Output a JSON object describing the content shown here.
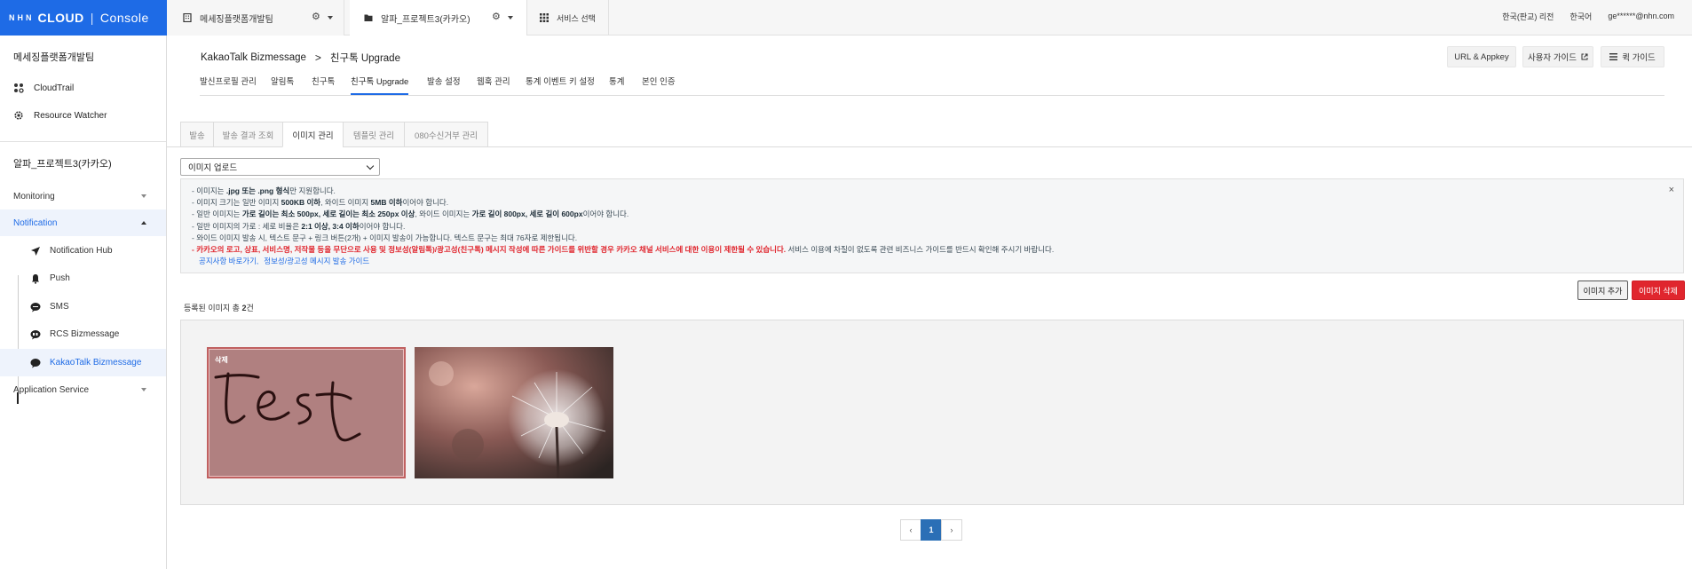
{
  "topbar": {
    "logo_brand": "NHN",
    "logo_cloud": "CLOUD",
    "logo_sep": "|",
    "logo_console": "Console",
    "org_name": "메세징플랫폼개발팀",
    "project_name": "알파_프로젝트3(카카오)",
    "service_select": "서비스 선택",
    "region": "한국(판교) 리전",
    "language": "한국어",
    "user": "ge******@nhn.com"
  },
  "sidebar": {
    "org_title": "메세징플랫폼개발팀",
    "org_links": [
      {
        "label": "CloudTrail",
        "icon": "cloudtrail-icon"
      },
      {
        "label": "Resource Watcher",
        "icon": "gear-icon"
      }
    ],
    "project_title": "알파_프로젝트3(카카오)",
    "categories": {
      "monitoring": "Monitoring",
      "notification": "Notification",
      "application_service": "Application Service"
    },
    "notification_items": [
      {
        "label": "Notification Hub",
        "icon": "paper-plane-icon"
      },
      {
        "label": "Push",
        "icon": "bell-icon"
      },
      {
        "label": "SMS",
        "icon": "sms-icon"
      },
      {
        "label": "RCS Bizmessage",
        "icon": "rcs-icon"
      },
      {
        "label": "KakaoTalk Bizmessage",
        "icon": "chat-bubble-icon"
      }
    ]
  },
  "header": {
    "breadcrumb_root": "KakaoTalk Bizmessage",
    "breadcrumb_arrow": ">",
    "breadcrumb_current": "친구톡 Upgrade",
    "buttons": {
      "appkey": "URL & Appkey",
      "user_guide": "사용자 가이드",
      "quick_guide": "퀵 가이드"
    },
    "tabs": [
      "발신프로필 관리",
      "알림톡",
      "친구톡",
      "친구톡 Upgrade",
      "발송 설정",
      "웹훅 관리",
      "통계 이벤트 키 설정",
      "통계",
      "본인 인증"
    ],
    "active_tab": "친구톡 Upgrade"
  },
  "sub_tabs": [
    "발송",
    "발송 결과 조회",
    "이미지 관리",
    "템플릿 관리",
    "080수신거부 관리"
  ],
  "active_sub_tab": "이미지 관리",
  "upload_select": {
    "value": "이미지 업로드"
  },
  "notice": {
    "l1_a": "- 이미지는 ",
    "l1_b": ".jpg 또는 .png 형식",
    "l1_c": "만 지원합니다.",
    "l2_a": "- 이미지 크기는 일반 이미지 ",
    "l2_b": "500KB 이하",
    "l2_c": ", 와이드 이미지 ",
    "l2_d": "5MB 이하",
    "l2_e": "이어야 합니다.",
    "l3_a": "- 일반 이미지는 ",
    "l3_b": "가로 길이는 최소 500px, 세로 길이는 최소 250px 이상",
    "l3_c": ", 와이드 이미지는 ",
    "l3_d": "가로 길이 800px, 세로 길이 600px",
    "l3_e": "이어야 합니다.",
    "l4_a": "- 일반 이미지의 가로 : 세로 비율은 ",
    "l4_b": "2:1 이상, 3:4 이하",
    "l4_c": "이어야 합니다.",
    "l5": "- 와이드 이미지 발송 시, 텍스트 문구 + 링크 버튼(2개) + 이미지 발송이 가능합니다. 텍스트 문구는 최대 76자로 제한됩니다.",
    "l6_a": "- 카카오의 로고, 상표, 서비스명, 저작물 등을 무단으로 사용 및 정보성(알림톡)/광고성(친구톡) 메시지 작성에 따른 가이드를 위반할 경우 카카오 채널 서비스에 대한 이용이 제한될 수 있습니다.",
    "l6_b": " 서비스 이용에 차질이 없도록 관련 비즈니스 가이드를 반드시 확인해 주시기 바랍니다.",
    "link1": "공지사항 바로가기,",
    "link2": "정보성/광고성 메시지 발송 가이드",
    "close": "×"
  },
  "actions": {
    "add": "이미지 추가",
    "delete": "이미지 삭제"
  },
  "count": {
    "prefix": "등록된 이미지 총 ",
    "num": "2",
    "suffix": "건"
  },
  "images": [
    {
      "label": "삭제",
      "selected": true,
      "content": "test"
    },
    {
      "label": "",
      "selected": false,
      "content": "dandelion"
    }
  ],
  "pagination": {
    "prev": "‹",
    "current": "1",
    "next": "›"
  },
  "colors": {
    "brand": "#1e6be6",
    "danger": "#e0262e",
    "page_active": "#2b6fb6"
  }
}
